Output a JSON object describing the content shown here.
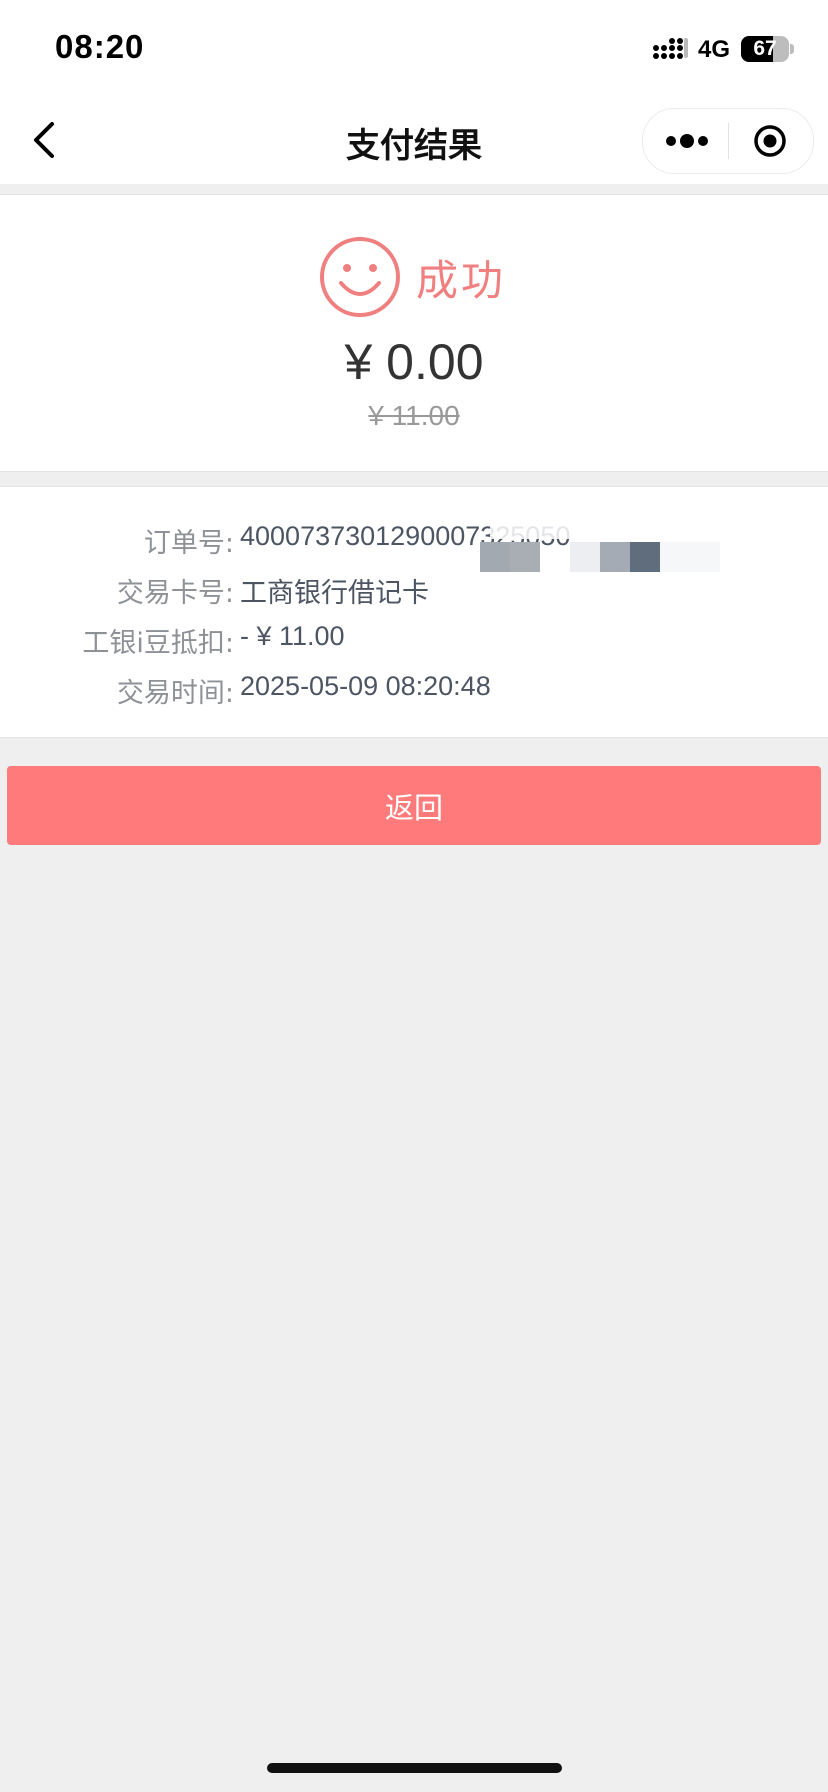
{
  "status_bar": {
    "time": "08:20",
    "network": "4G",
    "battery": "67",
    "battery_level": 0.67
  },
  "nav": {
    "title": "支付结果"
  },
  "result": {
    "status_text": "成功",
    "amount": "¥ 0.00",
    "original_amount": "¥ 11.00",
    "accent_color": "#f08080"
  },
  "details": [
    {
      "label": "订单号:",
      "value": "4000737301290007325050"
    },
    {
      "label": "交易卡号:",
      "value": "工商银行借记卡"
    },
    {
      "label": "工银i豆抵扣:",
      "value": "- ¥ 11.00"
    },
    {
      "label": "交易时间:",
      "value": "2025-05-09 08:20:48"
    }
  ],
  "actions": {
    "return_label": "返回",
    "button_color": "#ff7a7a"
  }
}
